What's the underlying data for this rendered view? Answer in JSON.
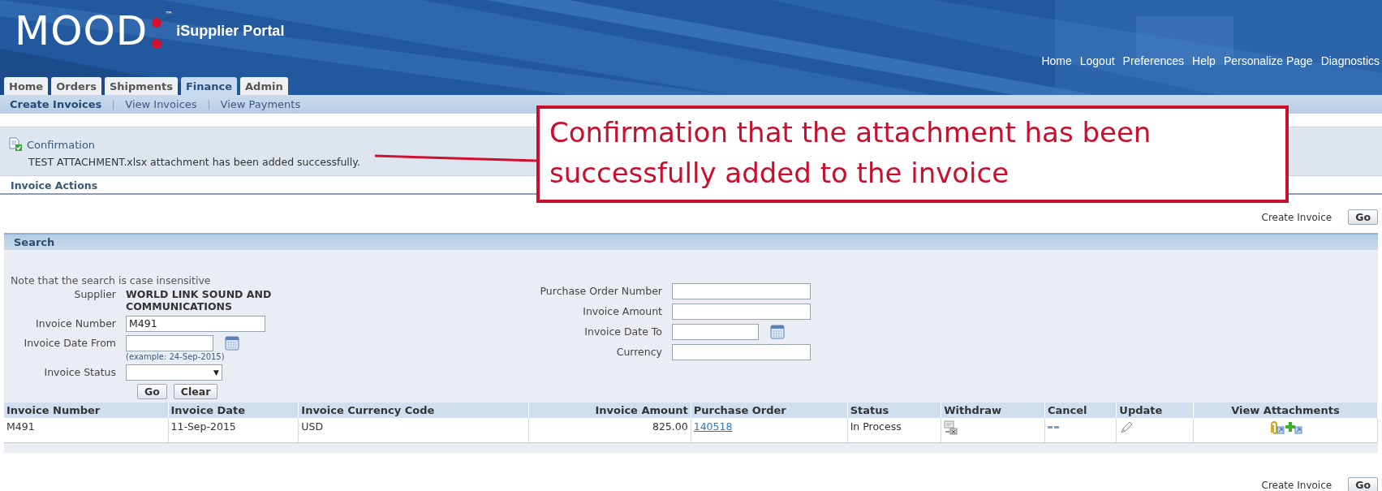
{
  "header": {
    "logo": "MOOD",
    "trademark": "™",
    "title": "iSupplier Portal",
    "links": [
      "Home",
      "Logout",
      "Preferences",
      "Help",
      "Personalize Page",
      "Diagnostics"
    ]
  },
  "tabs": [
    {
      "label": "Home",
      "selected": false
    },
    {
      "label": "Orders",
      "selected": false
    },
    {
      "label": "Shipments",
      "selected": false
    },
    {
      "label": "Finance",
      "selected": true
    },
    {
      "label": "Admin",
      "selected": false
    }
  ],
  "subtabs": [
    {
      "label": "Create Invoices",
      "selected": true
    },
    {
      "label": "View Invoices",
      "selected": false
    },
    {
      "label": "View Payments",
      "selected": false
    }
  ],
  "message": {
    "title": "Confirmation",
    "text": "TEST ATTACHMENT.xlsx attachment has been added successfully."
  },
  "section_title": "Invoice Actions",
  "top_action": {
    "label": "Create Invoice",
    "button": "Go"
  },
  "search": {
    "title": "Search",
    "note": "Note that the search is case insensitive",
    "left_fields": [
      {
        "kind": "static",
        "label": "Supplier",
        "value": "WORLD LINK SOUND AND COMMUNICATIONS"
      },
      {
        "kind": "text",
        "label": "Invoice Number",
        "value": "M491"
      },
      {
        "kind": "date",
        "label": "Invoice Date From",
        "hint": "(example: 24-Sep-2015)"
      },
      {
        "kind": "select",
        "label": "Invoice Status",
        "arrow": "▼"
      }
    ],
    "right_fields": [
      {
        "kind": "text",
        "label": "Purchase Order Number"
      },
      {
        "kind": "text",
        "label": "Invoice Amount"
      },
      {
        "kind": "date",
        "label": "Invoice Date To"
      },
      {
        "kind": "text",
        "label": "Currency"
      }
    ],
    "buttons": [
      "Go",
      "Clear"
    ]
  },
  "table": {
    "columns": [
      "Invoice Number",
      "Invoice Date",
      "Invoice Currency Code",
      "Invoice Amount",
      "Purchase Order",
      "Status",
      "Withdraw",
      "Cancel",
      "Update",
      "View Attachments"
    ],
    "rows": [
      {
        "invoice_number": "M491",
        "invoice_date": "11-Sep-2015",
        "currency_code": "USD",
        "invoice_amount": "825.00",
        "purchase_order": "140518",
        "status": "In Process"
      }
    ]
  },
  "bottom_action": {
    "label": "Create Invoice",
    "button": "Go"
  },
  "callout": {
    "text": "Confirmation that the attachment has been successfully added to the invoice"
  }
}
